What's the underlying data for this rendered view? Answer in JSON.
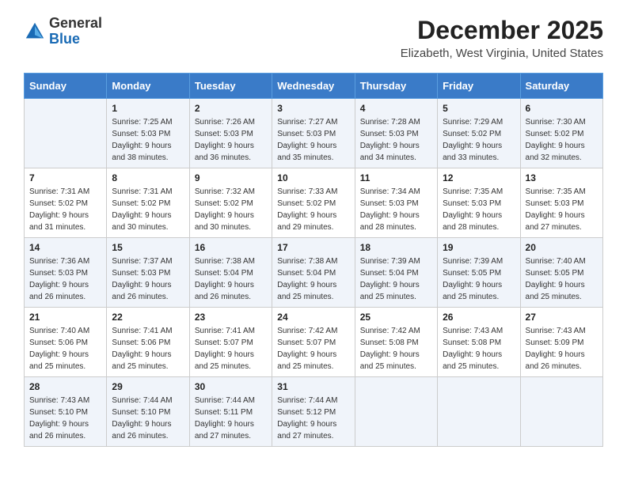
{
  "logo": {
    "general": "General",
    "blue": "Blue"
  },
  "title": "December 2025",
  "subtitle": "Elizabeth, West Virginia, United States",
  "weekdays": [
    "Sunday",
    "Monday",
    "Tuesday",
    "Wednesday",
    "Thursday",
    "Friday",
    "Saturday"
  ],
  "weeks": [
    [
      {
        "day": "",
        "info": ""
      },
      {
        "day": "1",
        "info": "Sunrise: 7:25 AM\nSunset: 5:03 PM\nDaylight: 9 hours\nand 38 minutes."
      },
      {
        "day": "2",
        "info": "Sunrise: 7:26 AM\nSunset: 5:03 PM\nDaylight: 9 hours\nand 36 minutes."
      },
      {
        "day": "3",
        "info": "Sunrise: 7:27 AM\nSunset: 5:03 PM\nDaylight: 9 hours\nand 35 minutes."
      },
      {
        "day": "4",
        "info": "Sunrise: 7:28 AM\nSunset: 5:03 PM\nDaylight: 9 hours\nand 34 minutes."
      },
      {
        "day": "5",
        "info": "Sunrise: 7:29 AM\nSunset: 5:02 PM\nDaylight: 9 hours\nand 33 minutes."
      },
      {
        "day": "6",
        "info": "Sunrise: 7:30 AM\nSunset: 5:02 PM\nDaylight: 9 hours\nand 32 minutes."
      }
    ],
    [
      {
        "day": "7",
        "info": "Sunrise: 7:31 AM\nSunset: 5:02 PM\nDaylight: 9 hours\nand 31 minutes."
      },
      {
        "day": "8",
        "info": "Sunrise: 7:31 AM\nSunset: 5:02 PM\nDaylight: 9 hours\nand 30 minutes."
      },
      {
        "day": "9",
        "info": "Sunrise: 7:32 AM\nSunset: 5:02 PM\nDaylight: 9 hours\nand 30 minutes."
      },
      {
        "day": "10",
        "info": "Sunrise: 7:33 AM\nSunset: 5:02 PM\nDaylight: 9 hours\nand 29 minutes."
      },
      {
        "day": "11",
        "info": "Sunrise: 7:34 AM\nSunset: 5:03 PM\nDaylight: 9 hours\nand 28 minutes."
      },
      {
        "day": "12",
        "info": "Sunrise: 7:35 AM\nSunset: 5:03 PM\nDaylight: 9 hours\nand 28 minutes."
      },
      {
        "day": "13",
        "info": "Sunrise: 7:35 AM\nSunset: 5:03 PM\nDaylight: 9 hours\nand 27 minutes."
      }
    ],
    [
      {
        "day": "14",
        "info": "Sunrise: 7:36 AM\nSunset: 5:03 PM\nDaylight: 9 hours\nand 26 minutes."
      },
      {
        "day": "15",
        "info": "Sunrise: 7:37 AM\nSunset: 5:03 PM\nDaylight: 9 hours\nand 26 minutes."
      },
      {
        "day": "16",
        "info": "Sunrise: 7:38 AM\nSunset: 5:04 PM\nDaylight: 9 hours\nand 26 minutes."
      },
      {
        "day": "17",
        "info": "Sunrise: 7:38 AM\nSunset: 5:04 PM\nDaylight: 9 hours\nand 25 minutes."
      },
      {
        "day": "18",
        "info": "Sunrise: 7:39 AM\nSunset: 5:04 PM\nDaylight: 9 hours\nand 25 minutes."
      },
      {
        "day": "19",
        "info": "Sunrise: 7:39 AM\nSunset: 5:05 PM\nDaylight: 9 hours\nand 25 minutes."
      },
      {
        "day": "20",
        "info": "Sunrise: 7:40 AM\nSunset: 5:05 PM\nDaylight: 9 hours\nand 25 minutes."
      }
    ],
    [
      {
        "day": "21",
        "info": "Sunrise: 7:40 AM\nSunset: 5:06 PM\nDaylight: 9 hours\nand 25 minutes."
      },
      {
        "day": "22",
        "info": "Sunrise: 7:41 AM\nSunset: 5:06 PM\nDaylight: 9 hours\nand 25 minutes."
      },
      {
        "day": "23",
        "info": "Sunrise: 7:41 AM\nSunset: 5:07 PM\nDaylight: 9 hours\nand 25 minutes."
      },
      {
        "day": "24",
        "info": "Sunrise: 7:42 AM\nSunset: 5:07 PM\nDaylight: 9 hours\nand 25 minutes."
      },
      {
        "day": "25",
        "info": "Sunrise: 7:42 AM\nSunset: 5:08 PM\nDaylight: 9 hours\nand 25 minutes."
      },
      {
        "day": "26",
        "info": "Sunrise: 7:43 AM\nSunset: 5:08 PM\nDaylight: 9 hours\nand 25 minutes."
      },
      {
        "day": "27",
        "info": "Sunrise: 7:43 AM\nSunset: 5:09 PM\nDaylight: 9 hours\nand 26 minutes."
      }
    ],
    [
      {
        "day": "28",
        "info": "Sunrise: 7:43 AM\nSunset: 5:10 PM\nDaylight: 9 hours\nand 26 minutes."
      },
      {
        "day": "29",
        "info": "Sunrise: 7:44 AM\nSunset: 5:10 PM\nDaylight: 9 hours\nand 26 minutes."
      },
      {
        "day": "30",
        "info": "Sunrise: 7:44 AM\nSunset: 5:11 PM\nDaylight: 9 hours\nand 27 minutes."
      },
      {
        "day": "31",
        "info": "Sunrise: 7:44 AM\nSunset: 5:12 PM\nDaylight: 9 hours\nand 27 minutes."
      },
      {
        "day": "",
        "info": ""
      },
      {
        "day": "",
        "info": ""
      },
      {
        "day": "",
        "info": ""
      }
    ]
  ]
}
